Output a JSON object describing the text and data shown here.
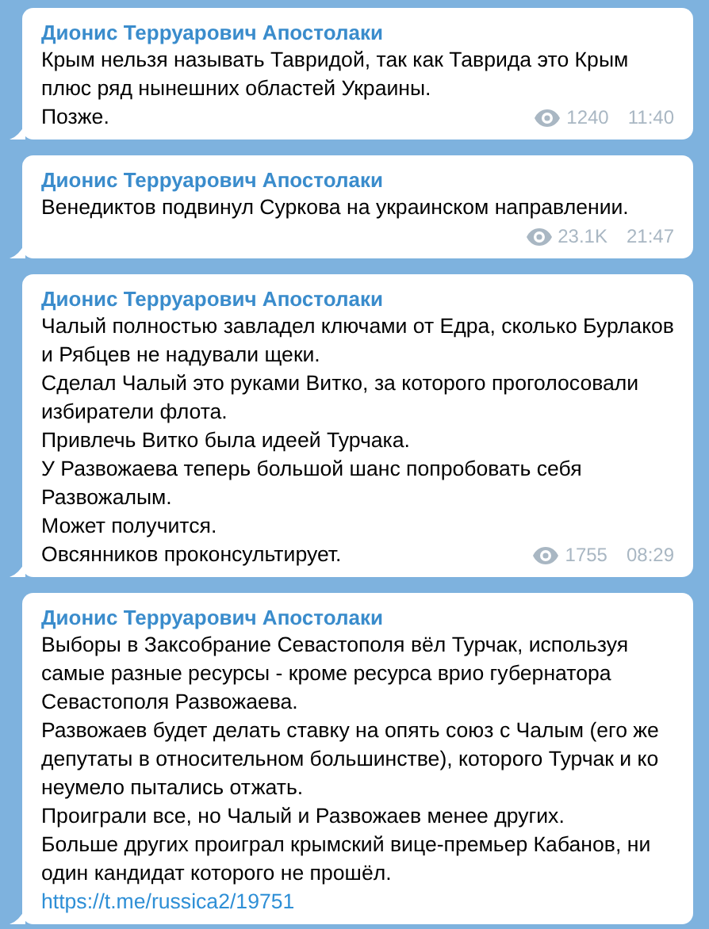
{
  "messages": [
    {
      "author": "Дионис Терруарович Апостолаки",
      "paragraphs": [
        "Крым нельзя называть Тавридой, так как Таврида это Крым плюс ряд нынешних областей Украины.",
        "Позже."
      ],
      "views": "1240",
      "time": "11:40"
    },
    {
      "author": "Дионис Терруарович Апостолаки",
      "paragraphs": [
        "Венедиктов подвинул Суркова на украинском направлении."
      ],
      "views": "23.1K",
      "time": "21:47"
    },
    {
      "author": "Дионис Терруарович Апостолаки",
      "paragraphs": [
        "Чалый полностью завладел ключами от Едра, сколько Бурлаков и Рябцев не надували щеки.",
        "Сделал Чалый это руками Витко, за которого проголосовали избиратели флота.",
        "Привлечь Витко была идеей Турчака.",
        "У Развожаева теперь большой шанс попробовать себя Развожалым.",
        "Может получится.",
        "Овсянников проконсультирует."
      ],
      "views": "1755",
      "time": "08:29"
    },
    {
      "author": "Дионис Терруарович Апостолаки",
      "paragraphs": [
        "Выборы в Заксобрание Севастополя вёл Турчак, используя самые разные ресурсы - кроме ресурса врио губернатора Севастополя Развожаева.",
        "Развожаев будет делать ставку на опять союз с Чалым (его же депутаты в относительном большинстве), которого Турчак и ко неумело пытались отжать.",
        "Проиграли все, но Чалый и Развожаев менее других.",
        "Больше других проиграл крымский вице-премьер Кабанов, ни один кандидат которого не прошёл."
      ],
      "link": "https://t.me/russica2/19751"
    }
  ]
}
